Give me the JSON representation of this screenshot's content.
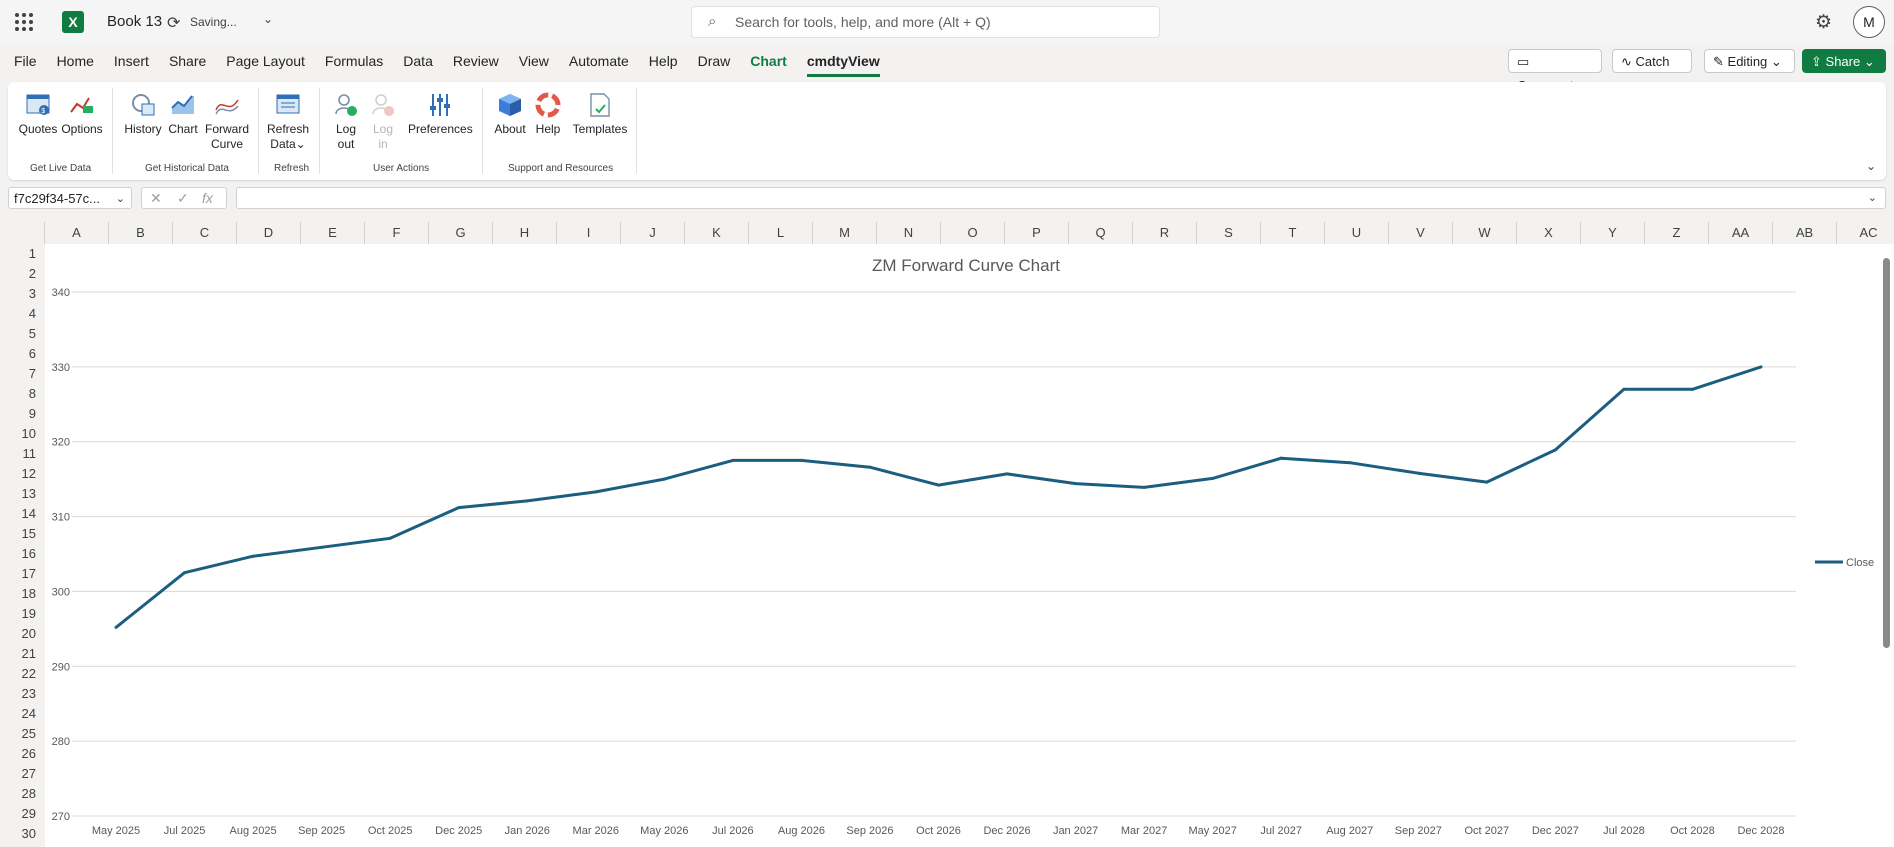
{
  "app": {
    "book_title": "Book 13",
    "saving_text": "Saving...",
    "search_placeholder": "Search for tools, help, and more (Alt + Q)",
    "avatar_initial": "M"
  },
  "menu": {
    "tabs": [
      "File",
      "Home",
      "Insert",
      "Share",
      "Page Layout",
      "Formulas",
      "Data",
      "Review",
      "View",
      "Automate",
      "Help",
      "Draw",
      "Chart",
      "cmdtyView"
    ],
    "comments_label": "Comments",
    "catchup_label": "Catch up",
    "editing_label": "Editing",
    "share_label": "Share"
  },
  "ribbon": {
    "quotes": "Quotes",
    "options": "Options",
    "history": "History",
    "chart": "Chart",
    "forward_curve_1": "Forward",
    "forward_curve_2": "Curve",
    "refresh_1": "Refresh",
    "refresh_2": "Data",
    "logout_1": "Log",
    "logout_2": "out",
    "login_1": "Log",
    "login_2": "in",
    "preferences": "Preferences",
    "about": "About",
    "help": "Help",
    "templates": "Templates",
    "groups": {
      "live": "Get Live Data",
      "historical": "Get Historical Data",
      "refresh": "Refresh",
      "user": "User Actions",
      "support": "Support and Resources"
    }
  },
  "formula_bar": {
    "name_box": "f7c29f34-57c...",
    "formula": ""
  },
  "grid": {
    "columns": [
      "A",
      "B",
      "C",
      "D",
      "E",
      "F",
      "G",
      "H",
      "I",
      "J",
      "K",
      "L",
      "M",
      "N",
      "O",
      "P",
      "Q",
      "R",
      "S",
      "T",
      "U",
      "V",
      "W",
      "X",
      "Y",
      "Z",
      "AA",
      "AB",
      "AC"
    ],
    "rows": [
      "1",
      "2",
      "3",
      "4",
      "5",
      "6",
      "7",
      "8",
      "9",
      "10",
      "11",
      "12",
      "13",
      "14",
      "15",
      "16",
      "17",
      "18",
      "19",
      "20",
      "21",
      "22",
      "23",
      "24",
      "25",
      "26",
      "27",
      "28",
      "29",
      "30"
    ]
  },
  "chart_data": {
    "type": "line",
    "title": "ZM Forward Curve Chart",
    "xlabel": "",
    "ylabel": "",
    "ylim": [
      270,
      340
    ],
    "y_ticks": [
      270,
      280,
      290,
      300,
      310,
      320,
      330,
      340
    ],
    "grid": true,
    "legend_position": "right",
    "line_color": "#1b5e80",
    "categories": [
      "May 2025",
      "Jul 2025",
      "Aug 2025",
      "Sep 2025",
      "Oct 2025",
      "Dec 2025",
      "Jan 2026",
      "Mar 2026",
      "May 2026",
      "Jul 2026",
      "Aug 2026",
      "Sep 2026",
      "Oct 2026",
      "Dec 2026",
      "Jan 2027",
      "Mar 2027",
      "May 2027",
      "Jul 2027",
      "Aug 2027",
      "Sep 2027",
      "Oct 2027",
      "Dec 2027",
      "Jul 2028",
      "Oct 2028",
      "Dec 2028"
    ],
    "series": [
      {
        "name": "Close",
        "values": [
          295.2,
          302.5,
          304.7,
          305.9,
          307.1,
          311.2,
          312.1,
          313.3,
          315.0,
          317.5,
          317.5,
          316.6,
          314.2,
          315.7,
          314.4,
          313.9,
          315.1,
          317.8,
          317.2,
          315.8,
          314.6,
          318.9,
          327.0,
          327.0,
          330.0
        ]
      }
    ]
  }
}
